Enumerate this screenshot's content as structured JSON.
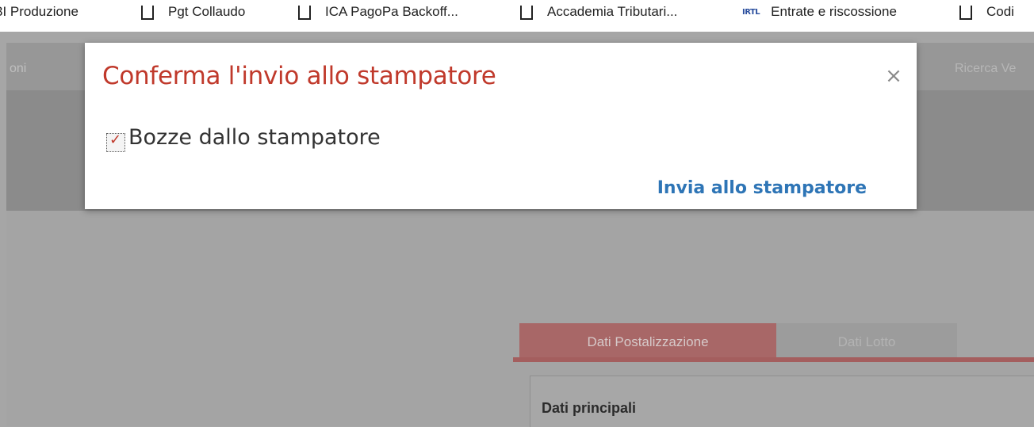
{
  "bookmarks": [
    {
      "label": "3I Produzione",
      "icon": "none"
    },
    {
      "label": "Pgt Collaudo",
      "icon": "bookmark-folder-icon"
    },
    {
      "label": "ICA PagoPa Backoff...",
      "icon": "bookmark-folder-icon"
    },
    {
      "label": "Accademia Tributari...",
      "icon": "bookmark-folder-icon"
    },
    {
      "label": "Entrate e riscossione",
      "icon": "irtl-logo-icon"
    },
    {
      "label": "Codi",
      "icon": "bookmark-folder-icon"
    }
  ],
  "app": {
    "nav_left": "oni",
    "nav_right": "Ricerca Ve",
    "tabs": [
      {
        "label": "Dati Postalizzazione",
        "active": true
      },
      {
        "label": "Dati Lotto",
        "active": false
      }
    ],
    "panel_title": "Dati principali"
  },
  "modal": {
    "title": "Conferma l'invio allo stampatore",
    "close_icon": "×",
    "checkbox_label": "Bozze dallo stampatore",
    "checkbox_checked": true,
    "send_label": "Invia allo stampatore"
  },
  "colors": {
    "title_red": "#c0392b",
    "link_blue": "#2e75b6",
    "tab_active": "#a86767"
  }
}
